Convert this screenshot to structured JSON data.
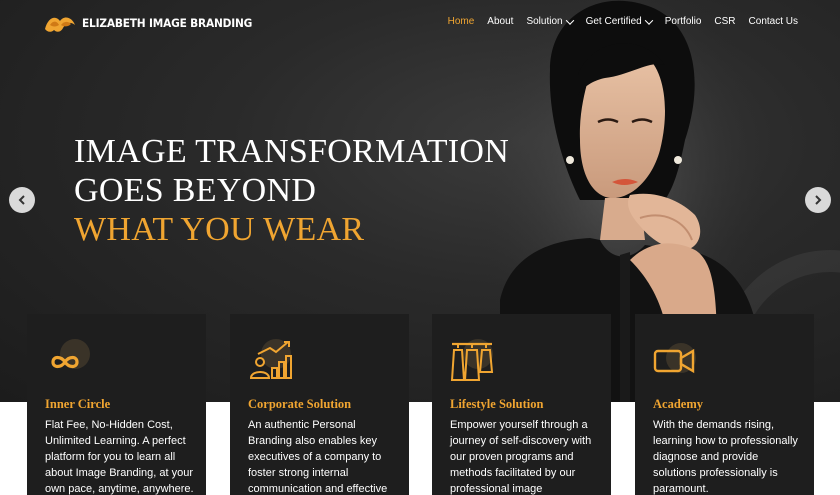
{
  "brand": {
    "name": "ELIZABETH IMAGE BRANDING"
  },
  "nav": {
    "items": [
      {
        "label": "Home",
        "active": true,
        "dropdown": false
      },
      {
        "label": "About",
        "active": false,
        "dropdown": false
      },
      {
        "label": "Solution",
        "active": false,
        "dropdown": true
      },
      {
        "label": "Get Certified",
        "active": false,
        "dropdown": true
      },
      {
        "label": "Portfolio",
        "active": false,
        "dropdown": false
      },
      {
        "label": "CSR",
        "active": false,
        "dropdown": false
      },
      {
        "label": "Contact Us",
        "active": false,
        "dropdown": false
      }
    ]
  },
  "hero": {
    "line1": "IMAGE TRANSFORMATION",
    "line2": "GOES BEYOND",
    "line3": "WHAT YOU WEAR"
  },
  "cards": [
    {
      "icon": "infinity-icon",
      "title": "Inner Circle",
      "desc": "Flat Fee, No-Hidden Cost, Unlimited Learning. A perfect platform for you to learn all about Image Branding, at your own pace, anytime, anywhere."
    },
    {
      "icon": "growth-chart-icon",
      "title": "Corporate Solution",
      "desc": "An authentic Personal Branding also enables key executives of a company to foster strong internal communication and effective"
    },
    {
      "icon": "wardrobe-icon",
      "title": "Lifestyle Solution",
      "desc": "Empower yourself through a journey of self-discovery with our proven programs and methods facilitated by our professional image"
    },
    {
      "icon": "video-camera-icon",
      "title": "Academy",
      "desc": "With the demands rising, learning how to professionally diagnose and provide solutions professionally is paramount."
    }
  ],
  "colors": {
    "accent": "#f0a531",
    "card_bg": "#1e1e1e",
    "hero_bg": "#2a2a2a"
  }
}
